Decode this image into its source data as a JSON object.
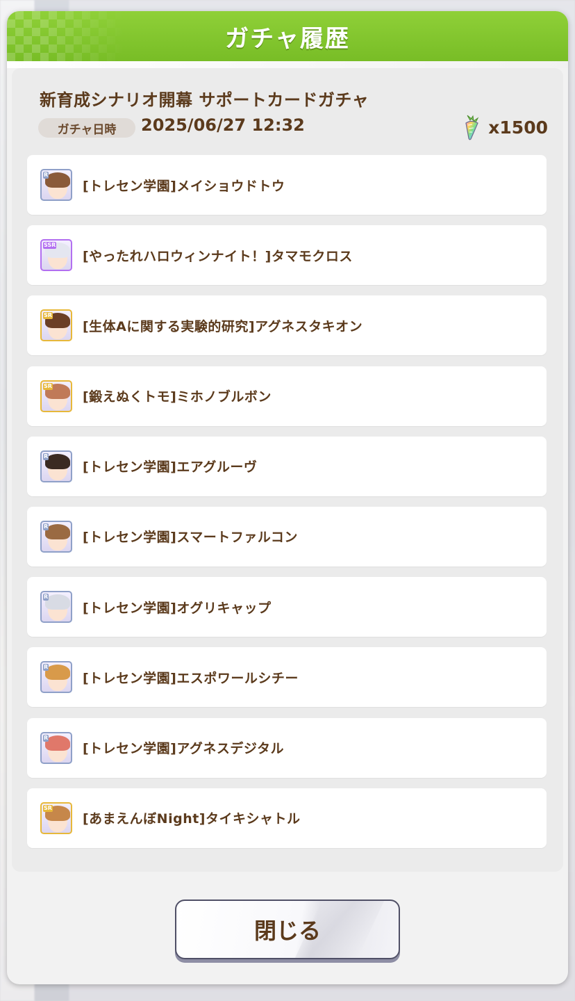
{
  "modal": {
    "title": "ガチャ履歴"
  },
  "gacha": {
    "name": "新育成シナリオ開幕 サポートカードガチャ",
    "date_label": "ガチャ日時",
    "date_value": "2025/06/27 12:32",
    "cost_icon": "carrot-jewel-icon",
    "cost_value": "x1500"
  },
  "results": [
    {
      "label": "[トレセン学園]メイショウドトウ",
      "rarity": "R",
      "frame_color": "#8fa0c8",
      "hair_color": "#8a5a3a"
    },
    {
      "label": "[やったれハロウィンナイト！]タマモクロス",
      "rarity": "SSR",
      "frame_color": "#b26ff0",
      "hair_color": "#e4e6f0"
    },
    {
      "label": "[生体Aに関する実験的研究]アグネスタキオン",
      "rarity": "SR",
      "frame_color": "#e7b83a",
      "hair_color": "#6b3f26"
    },
    {
      "label": "[鍛えぬくトモ]ミホノブルボン",
      "rarity": "SR",
      "frame_color": "#e7b83a",
      "hair_color": "#c07a58"
    },
    {
      "label": "[トレセン学園]エアグルーヴ",
      "rarity": "R",
      "frame_color": "#8fa0c8",
      "hair_color": "#3a2a22"
    },
    {
      "label": "[トレセン学園]スマートファルコン",
      "rarity": "R",
      "frame_color": "#8fa0c8",
      "hair_color": "#9a6a42"
    },
    {
      "label": "[トレセン学園]オグリキャップ",
      "rarity": "R",
      "frame_color": "#8fa0c8",
      "hair_color": "#d8dbe4"
    },
    {
      "label": "[トレセン学園]エスポワールシチー",
      "rarity": "R",
      "frame_color": "#8fa0c8",
      "hair_color": "#d89a4a"
    },
    {
      "label": "[トレセン学園]アグネスデジタル",
      "rarity": "R",
      "frame_color": "#8fa0c8",
      "hair_color": "#e0786a"
    },
    {
      "label": "[あまえんぼNight]タイキシャトル",
      "rarity": "SR",
      "frame_color": "#e7b83a",
      "hair_color": "#c6874a"
    }
  ],
  "close_button": {
    "label": "閉じる"
  },
  "colors": {
    "header_green": "#84c82f",
    "text_brown": "#5b3a1c",
    "panel_bg": "#ebebeb"
  }
}
